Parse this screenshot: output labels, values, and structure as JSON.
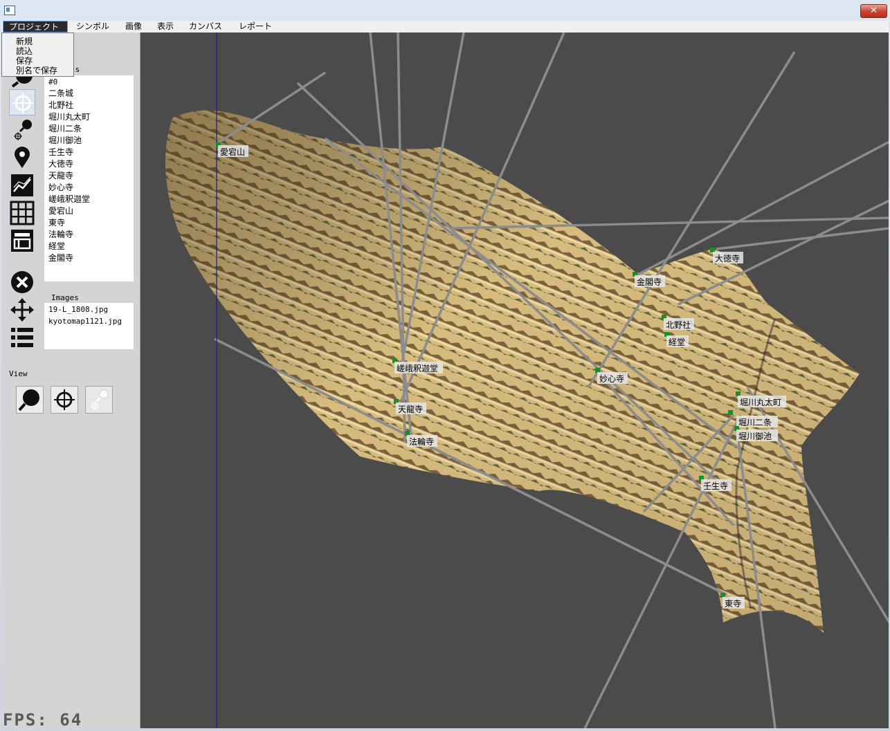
{
  "window": {
    "close_label": "✕"
  },
  "menubar": {
    "items": [
      {
        "label": "プロジェクト"
      },
      {
        "label": "シンボル"
      },
      {
        "label": "画像"
      },
      {
        "label": "表示"
      },
      {
        "label": "カンバス"
      },
      {
        "label": "レポート"
      }
    ]
  },
  "project_menu": {
    "items": [
      "新規",
      "読込",
      "保存",
      "別名で保存"
    ]
  },
  "sidebar": {
    "symbols_header": "ls",
    "symbols": [
      "#0",
      "二条城",
      "北野社",
      "堀川丸太町",
      "堀川二条",
      "堀川御池",
      "壬生寺",
      "大徳寺",
      "天龍寺",
      "妙心寺",
      "嵯峨釈迦堂",
      "愛宕山",
      "東寺",
      "法輪寺",
      "経堂",
      "金閣寺"
    ],
    "images_header": "Images",
    "images": [
      "19-L_1808.jpg",
      "kyotomap1121.jpg"
    ],
    "view_header": "View"
  },
  "status": {
    "fps": "FPS: 64"
  },
  "canvas": {
    "markers": [
      {
        "label": "愛宕山"
      },
      {
        "label": "大徳寺"
      },
      {
        "label": "金閣寺"
      },
      {
        "label": "北野社"
      },
      {
        "label": "経堂"
      },
      {
        "label": "嵯峨釈迦堂"
      },
      {
        "label": "妙心寺"
      },
      {
        "label": "天龍寺"
      },
      {
        "label": "法輪寺"
      },
      {
        "label": "堀川丸太町"
      },
      {
        "label": "堀川二条"
      },
      {
        "label": "堀川御池"
      },
      {
        "label": "壬生寺"
      },
      {
        "label": "東寺"
      }
    ]
  },
  "colors": {
    "canvas_bg": "#4b4b4b",
    "marker": "#1f8c2a",
    "line": "#8c8c8c",
    "map_sand": "#d9bf82",
    "map_dark": "#3a4a2c"
  }
}
